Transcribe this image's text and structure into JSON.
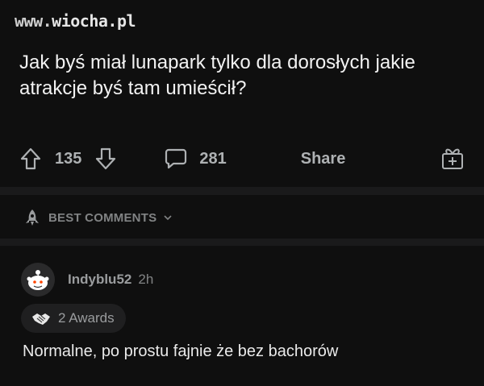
{
  "watermark": {
    "prefix": "www.",
    "site": "wiocha.pl"
  },
  "post": {
    "title": "Jak byś miał lunapark tylko dla dorosłych jakie atrakcje byś tam umieścił?"
  },
  "actions": {
    "upvotes": "135",
    "comments": "281",
    "share_label": "Share"
  },
  "comments_section": {
    "sort_label": "BEST COMMENTS"
  },
  "comment": {
    "username": "Indyblu52",
    "time": "2h",
    "awards": "2 Awards",
    "body": "Normalne, po prostu fajnie że bez bachorów"
  },
  "colors": {
    "background": "#0f0f0f",
    "divider": "#1a1a1b",
    "text": "#d7dadc",
    "muted": "#818384"
  }
}
